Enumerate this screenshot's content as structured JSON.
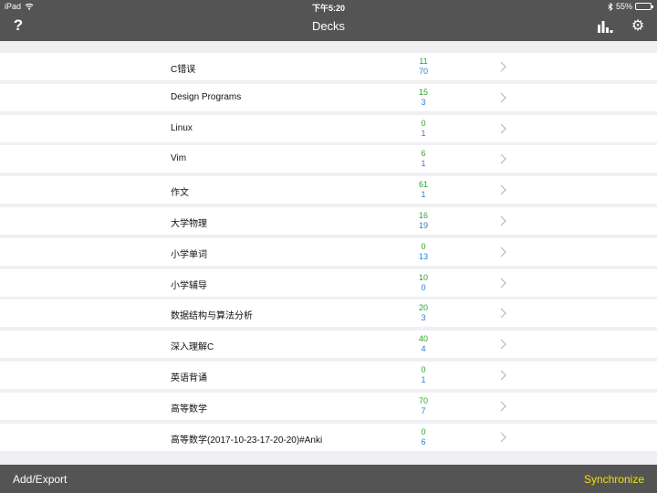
{
  "status_bar": {
    "device": "iPad",
    "time": "下午5:20",
    "battery_percent": "55%",
    "battery_level": 0.55
  },
  "nav": {
    "title": "Decks",
    "help_label": "?"
  },
  "decks": [
    {
      "name": "C错误",
      "due": "11",
      "new": "70"
    },
    {
      "name": "Design Programs",
      "due": "15",
      "new": "3"
    },
    {
      "name": "Linux",
      "due": "0",
      "new": "1"
    },
    {
      "name": "Vim",
      "due": "6",
      "new": "1"
    },
    {
      "name": "作文",
      "due": "61",
      "new": "1"
    },
    {
      "name": "大学物理",
      "due": "16",
      "new": "19"
    },
    {
      "name": "小学单词",
      "due": "0",
      "new": "13"
    },
    {
      "name": "小学辅导",
      "due": "10",
      "new": "0"
    },
    {
      "name": "数据结构与算法分析",
      "due": "20",
      "new": "3"
    },
    {
      "name": "深入理解C",
      "due": "40",
      "new": "4"
    },
    {
      "name": "英语背诵",
      "due": "0",
      "new": "1"
    },
    {
      "name": "高等数学",
      "due": "70",
      "new": "7"
    },
    {
      "name": "高等数学(2017-10-23-17-20-20)#Anki",
      "due": "0",
      "new": "6"
    }
  ],
  "bottom_bar": {
    "add_export_label": "Add/Export",
    "sync_label": "Synchronize"
  },
  "colors": {
    "bar": "#545454",
    "due": "#2aa52a",
    "new": "#2a7fd4",
    "sync": "#f2e200"
  }
}
